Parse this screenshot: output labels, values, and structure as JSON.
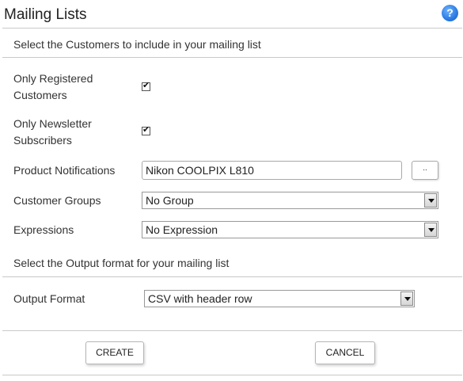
{
  "header": {
    "title": "Mailing Lists",
    "help_label": "?"
  },
  "customers_section": {
    "heading": "Select the Customers to include in your mailing list",
    "only_registered": {
      "label_line1": "Only Registered",
      "label_line2": "Customers",
      "checked": true
    },
    "only_newsletter": {
      "label_line1": "Only Newsletter",
      "label_line2": "Subscribers",
      "checked": true
    },
    "product_notifications": {
      "label": "Product Notifications",
      "value": "Nikon COOLPIX L810",
      "browse_label": ".."
    },
    "customer_groups": {
      "label": "Customer Groups",
      "selected": "No Group"
    },
    "expressions": {
      "label": "Expressions",
      "selected": "No Expression"
    }
  },
  "output_section": {
    "heading": "Select the Output format for your mailing list",
    "output_format": {
      "label": "Output Format",
      "selected": "CSV with header row"
    }
  },
  "actions": {
    "create_label": "CREATE",
    "cancel_label": "CANCEL"
  }
}
